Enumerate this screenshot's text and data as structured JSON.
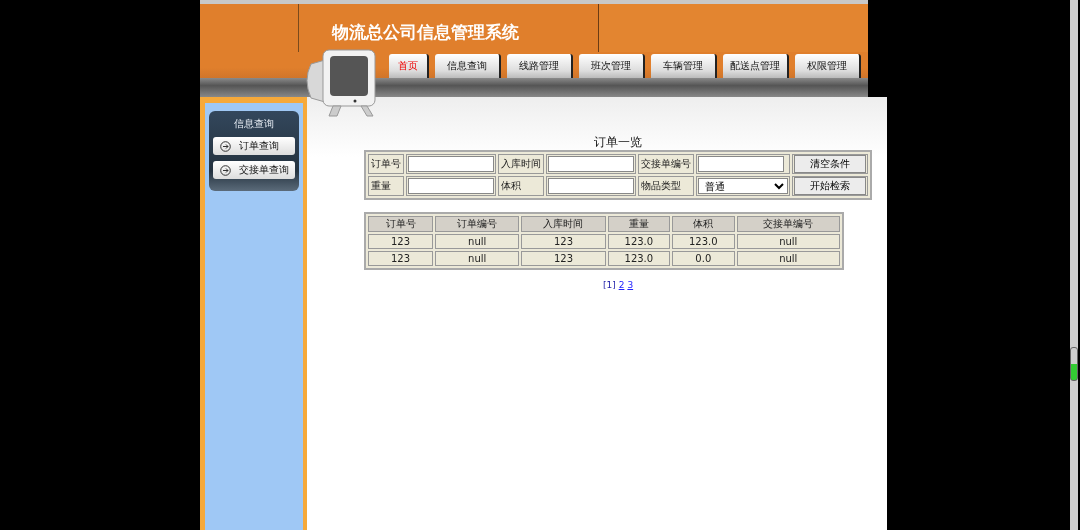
{
  "app_title": "物流总公司信息管理系统",
  "nav_tabs": [
    {
      "label": "首页",
      "selected": true
    },
    {
      "label": "信息查询",
      "selected": false
    },
    {
      "label": "线路管理",
      "selected": false
    },
    {
      "label": "班次管理",
      "selected": false
    },
    {
      "label": "车辆管理",
      "selected": false
    },
    {
      "label": "配送点管理",
      "selected": false
    },
    {
      "label": "权限管理",
      "selected": false
    }
  ],
  "sidebar": {
    "title": "信息查询",
    "items": [
      {
        "label": "订单查询"
      },
      {
        "label": "交接单查询"
      }
    ]
  },
  "search_form": {
    "title": "订单一览",
    "fields": [
      {
        "label": "订单号",
        "kind": "text"
      },
      {
        "label": "入库时间",
        "kind": "text"
      },
      {
        "label": "交接单编号",
        "kind": "text"
      },
      {
        "label": "重量",
        "kind": "text"
      },
      {
        "label": "体积",
        "kind": "text"
      },
      {
        "label": "物品类型",
        "kind": "select",
        "value": "普通"
      }
    ],
    "buttons": [
      "清空条件",
      "开始检索"
    ]
  },
  "table": {
    "columns": [
      "订单号",
      "订单编号",
      "入库时间",
      "重量",
      "体积",
      "交接单编号"
    ],
    "rows": [
      [
        "123",
        "null",
        "123",
        "123.0",
        "123.0",
        "null"
      ],
      [
        "123",
        "null",
        "123",
        "123.0",
        "0.0",
        "null"
      ]
    ]
  },
  "pager": [
    {
      "label": "[1]",
      "selected": true
    },
    {
      "label": "2",
      "selected": false
    },
    {
      "label": "3",
      "selected": false
    }
  ]
}
